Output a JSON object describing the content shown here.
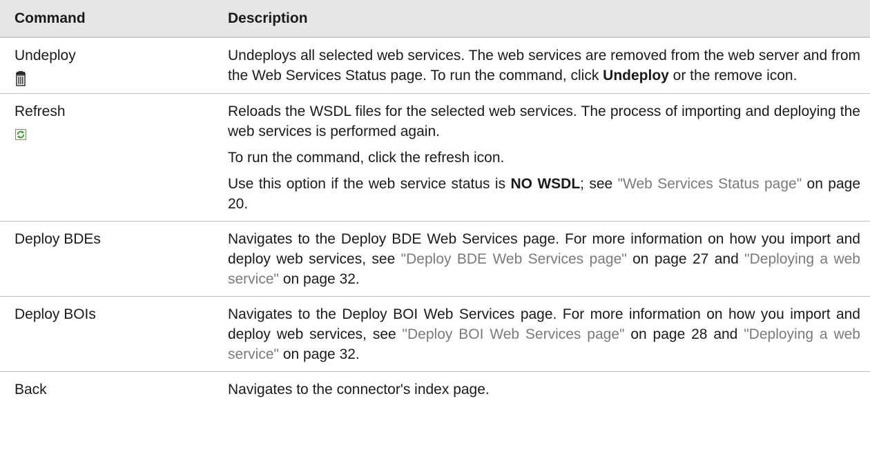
{
  "table": {
    "header": {
      "command": "Command",
      "description": "Description"
    },
    "rows": [
      {
        "command": "Undeploy",
        "icon": "trash-icon",
        "desc": {
          "p1_a": "Undeploys all selected web services. The web services are removed from the web server and from the Web Services Status page. To run the com­mand, click ",
          "p1_b": "Undeploy",
          "p1_c": " or the remove icon."
        }
      },
      {
        "command": "Refresh",
        "icon": "refresh-icon",
        "desc": {
          "p1": "Reloads the WSDL files for the selected web services. The process of im­porting and deploying the web services is performed again.",
          "p2": "To run the command, click the refresh icon.",
          "p3_a": "Use this option if the web service status is ",
          "p3_b": "NO WSDL",
          "p3_c": "; see ",
          "p3_link": "\"Web Services Status page\"",
          "p3_d": " on page 20."
        }
      },
      {
        "command": "Deploy BDEs",
        "desc": {
          "p1_a": "Navigates to the Deploy BDE Web Services page. For more information on how you import and deploy web services, see ",
          "p1_link1": "\"Deploy BDE Web Services page\"",
          "p1_b": " on page 27 and ",
          "p1_link2": "\"Deploying a web service\"",
          "p1_c": " on page 32."
        }
      },
      {
        "command": "Deploy BOIs",
        "desc": {
          "p1_a": "Navigates to the Deploy BOI Web Services page. For more information on how you import and deploy web services, see ",
          "p1_link1": "\"Deploy BOI Web Services page\"",
          "p1_b": " on page 28 and ",
          "p1_link2": "\"Deploying a web service\"",
          "p1_c": " on page 32."
        }
      },
      {
        "command": "Back",
        "desc": {
          "p1": "Navigates to the connector's index page."
        }
      }
    ]
  },
  "colors": {
    "header_bg": "#e6e6e6",
    "link": "#7a7a7a",
    "text": "#1a1a1a"
  }
}
